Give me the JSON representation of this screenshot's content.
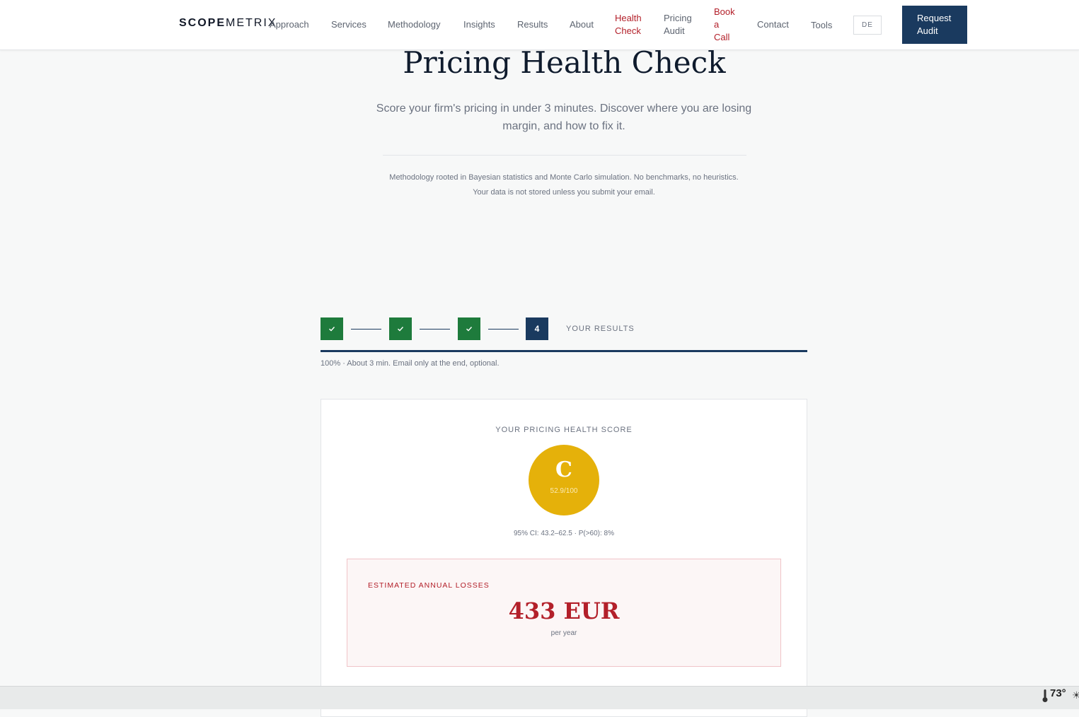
{
  "nav": {
    "logo_bold": "SCOPE",
    "logo_light": "METRIX",
    "links": [
      "Approach",
      "Services",
      "Methodology",
      "Insights",
      "Results",
      "About"
    ],
    "health_check": [
      "Health",
      "Check"
    ],
    "pricing_audit": [
      "Pricing",
      "Audit"
    ],
    "book_call": [
      "Book",
      "a",
      "Call"
    ],
    "contact": "Contact",
    "tools": "Tools",
    "lang": "DE",
    "cta": [
      "Request",
      "Audit"
    ]
  },
  "hero": {
    "title": "Pricing Health Check",
    "subtitle": "Score your firm's pricing in under 3 minutes. Discover where you are losing margin, and how to fix it.",
    "methodology_line1": "Methodology rooted in Bayesian statistics and Monte Carlo simulation. No benchmarks, no heuristics.",
    "methodology_line2": "Your data is not stored unless you submit your email."
  },
  "stepper": {
    "current_step": "4",
    "step_label": "YOUR RESULTS",
    "progress": 1.0,
    "progress_text": "100% · About 3 min. Email only at the end, optional."
  },
  "result": {
    "score_label": "YOUR PRICING HEALTH SCORE",
    "grade": "C",
    "score": "52.9/100",
    "ci": "95% CI: 43.2–62.5 · P(>60): 8%",
    "loss_label": "ESTIMATED ANNUAL LOSSES",
    "loss_value": "433 EUR",
    "loss_unit": "per year"
  },
  "taskbar": {
    "temperature": "73°"
  },
  "colors": {
    "navy": "#1a3a5f",
    "red": "#b3202a",
    "green": "#1e7b3c",
    "gold": "#e5b10a"
  }
}
